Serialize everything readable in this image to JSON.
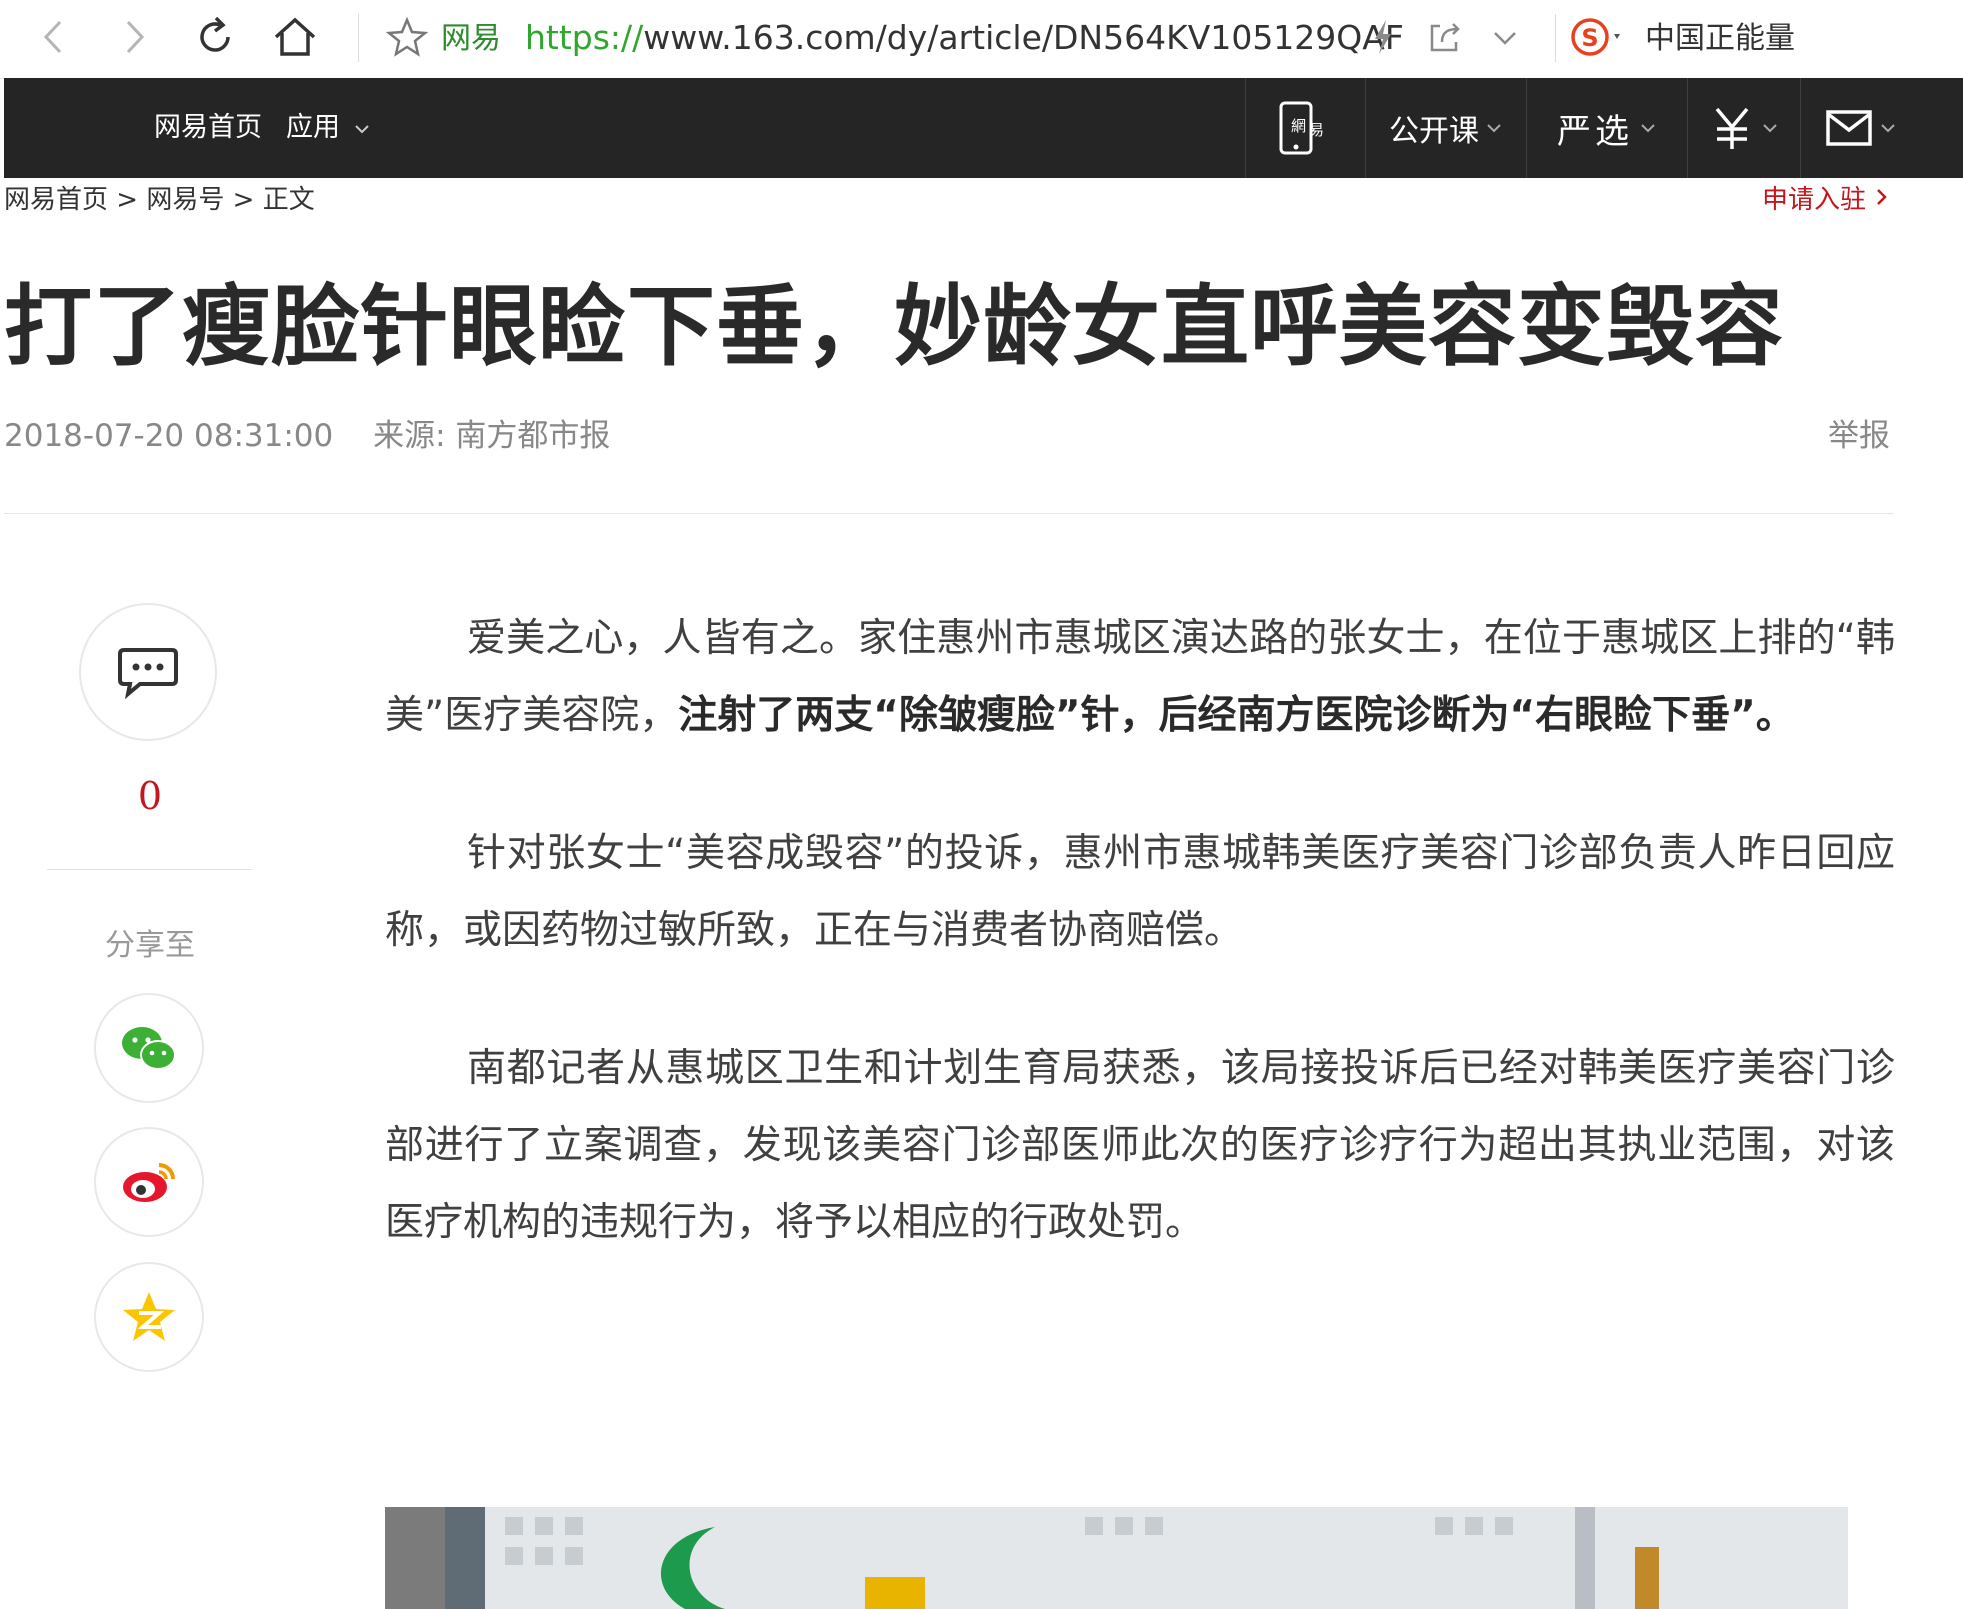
{
  "browser": {
    "site_name": "网易",
    "url_protocol": "https://",
    "url_rest": "www.163.com/dy/article/DN564KV105129QAF",
    "search_engine_label": "中国正能量"
  },
  "site_nav": {
    "home": "网易首页",
    "apps": "应用",
    "open_course": "公开课",
    "yanxuan": "严选",
    "lottery_icon": "yen-icon",
    "mail_icon": "mail-icon",
    "mobile_icon": "netease-mobile-icon"
  },
  "breadcrumb": {
    "home": "网易首页",
    "sep": ">",
    "channel": "网易号",
    "current": "正文"
  },
  "join_link": "申请入驻",
  "article": {
    "title": "打了瘦脸针眼睑下垂，妙龄女直呼美容变毁容",
    "datetime": "2018-07-20 08:31:00",
    "source": "来源: 南方都市报",
    "report": "举报",
    "p1_pre": "爱美之心，人皆有之。家住惠州市惠城区演达路的张女士，在位于惠城区上排的“韩美”医疗美容院，",
    "p1_bold": "注射了两支“除皱瘦脸”针，后经南方医院诊断为“右眼睑下垂”。",
    "p2": "针对张女士“美容成毁容”的投诉，惠州市惠城韩美医疗美容门诊部负责人昨日回应称，或因药物过敏所致，正在与消费者协商赔偿。",
    "p3": "南都记者从惠城区卫生和计划生育局获悉，该局接投诉后已经对韩美医疗美容门诊部进行了立案调查，发现该美容门诊部医师此次的医疗诊疗行为超出其执业范围，对该医疗机构的违规行为，将予以相应的行政处罚。"
  },
  "share": {
    "comment_count": "0",
    "label": "分享至"
  },
  "colors": {
    "accent_red": "#c4161c",
    "nav_bg": "#252525",
    "url_green": "#2fa72f"
  }
}
